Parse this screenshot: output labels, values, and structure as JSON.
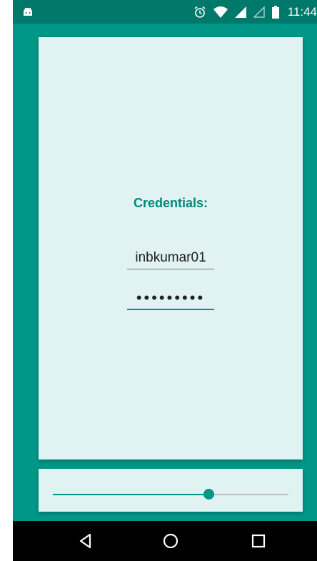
{
  "status_bar": {
    "time": "11:44",
    "icons": [
      "android-icon",
      "alarm-icon",
      "wifi-icon",
      "signal-icon",
      "signal-empty-icon",
      "battery-icon"
    ]
  },
  "credentials": {
    "title": "Credentials:",
    "username": "inbkumar01",
    "password_mask": "•••••••••"
  },
  "slider": {
    "value_fraction": 0.66
  },
  "nav_bar": {
    "buttons": [
      "back-icon",
      "home-icon",
      "recent-apps-icon"
    ]
  },
  "colors": {
    "primary": "#009688",
    "primary_dark": "#00796B",
    "card_bg": "#E0F2F1",
    "title": "#00897B"
  }
}
